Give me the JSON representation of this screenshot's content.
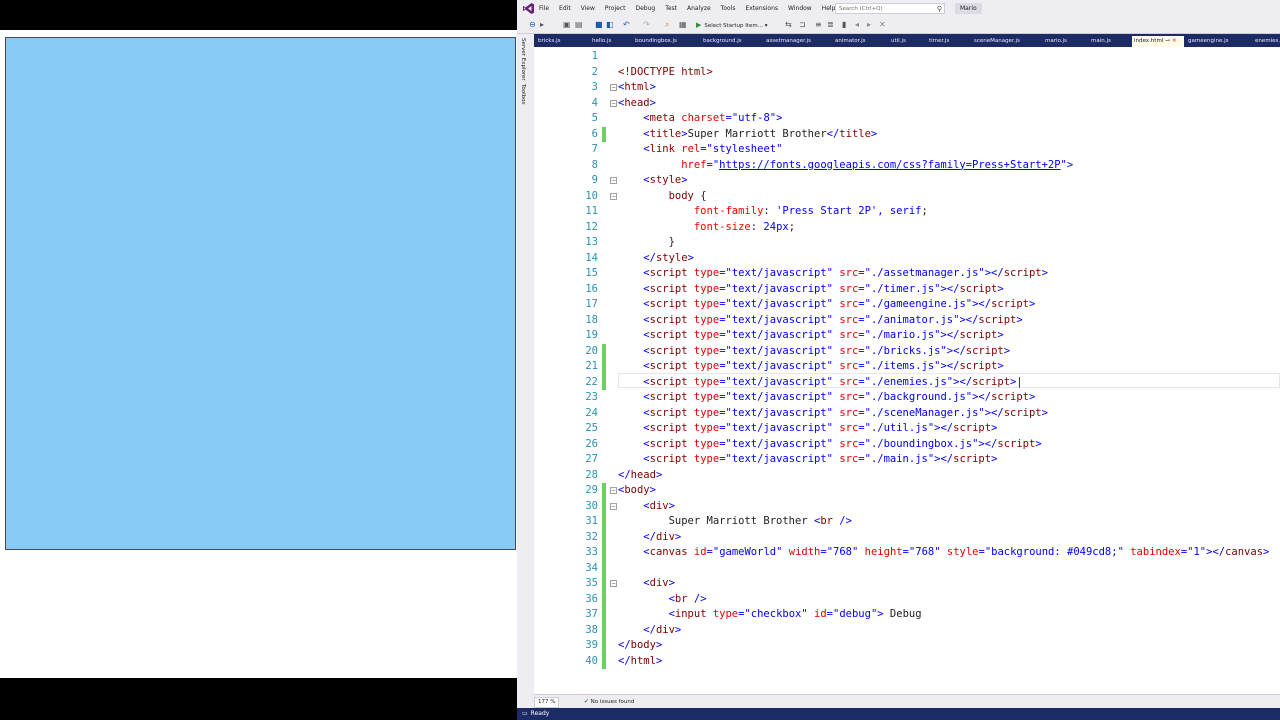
{
  "browser": {
    "canvas_color": "#87cbf6"
  },
  "vs": {
    "menu": [
      "File",
      "Edit",
      "View",
      "Project",
      "Debug",
      "Test",
      "Analyze",
      "Tools",
      "Extensions",
      "Window",
      "Help"
    ],
    "search_placeholder": "Search (Ctrl+Q)",
    "solution_name": "Mario",
    "startup_label": "Select Startup Item...",
    "side_panels": [
      "Server Explorer",
      "Toolbox"
    ],
    "tabs": [
      "bricks.js",
      "hello.js",
      "boundingbox.js",
      "background.js",
      "assetmanager.js",
      "animator.js",
      "util.js",
      "timer.js",
      "sceneManager.js",
      "mario.js",
      "main.js",
      "index.html",
      "gameengine.js",
      "enemies.js"
    ],
    "active_tab": "index.html",
    "zoom": "177 %",
    "issues": "No issues found",
    "status": "Ready",
    "accent": "#1c2b66"
  },
  "code": {
    "line_numbers": [
      "1",
      "2",
      "3",
      "4",
      "5",
      "6",
      "7",
      "8",
      "9",
      "10",
      "11",
      "12",
      "13",
      "14",
      "15",
      "16",
      "17",
      "18",
      "19",
      "20",
      "21",
      "22",
      "23",
      "24",
      "25",
      "26",
      "27",
      "28",
      "29",
      "30",
      "31",
      "32",
      "33",
      "34",
      "35",
      "36",
      "37",
      "38",
      "39",
      "40"
    ],
    "doctype": "<!DOCTYPE html>",
    "title": "Super Marriott Brother",
    "font_url": "https://fonts.googleapis.com/css?family=Press+Start+2P",
    "font_family": "'Press Start 2P', serif",
    "font_size": "24px",
    "scripts": [
      "./assetmanager.js",
      "./timer.js",
      "./gameengine.js",
      "./animator.js",
      "./mario.js",
      "./bricks.js",
      "./items.js",
      "./enemies.js",
      "./background.js",
      "./sceneManager.js",
      "./util.js",
      "./boundingbox.js",
      "./main.js"
    ],
    "body_text": "Super Marriott Brother",
    "canvas_id": "gameWorld",
    "canvas_width": "768",
    "canvas_height": "768",
    "canvas_style": "background: #049cd8;",
    "canvas_tabindex": "1",
    "checkbox_id": "debug",
    "checkbox_label": "Debug"
  }
}
